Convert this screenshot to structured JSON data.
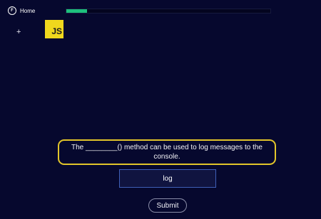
{
  "nav": {
    "home_label": "Home",
    "home_icon": "home-icon",
    "home_icon_glyph": "F"
  },
  "progress": {
    "percent": 10,
    "color": "#1ec07d"
  },
  "toolbar": {
    "add_label": "+"
  },
  "logo": {
    "text": "JS",
    "color": "#f0d81d"
  },
  "question": {
    "text": "The ________() method can be used to log messages to the console."
  },
  "answer": {
    "value": "log"
  },
  "actions": {
    "submit_label": "Submit"
  },
  "colors": {
    "background": "#06082e",
    "accent": "#e2c52a",
    "input_border": "#3f5fb8"
  }
}
